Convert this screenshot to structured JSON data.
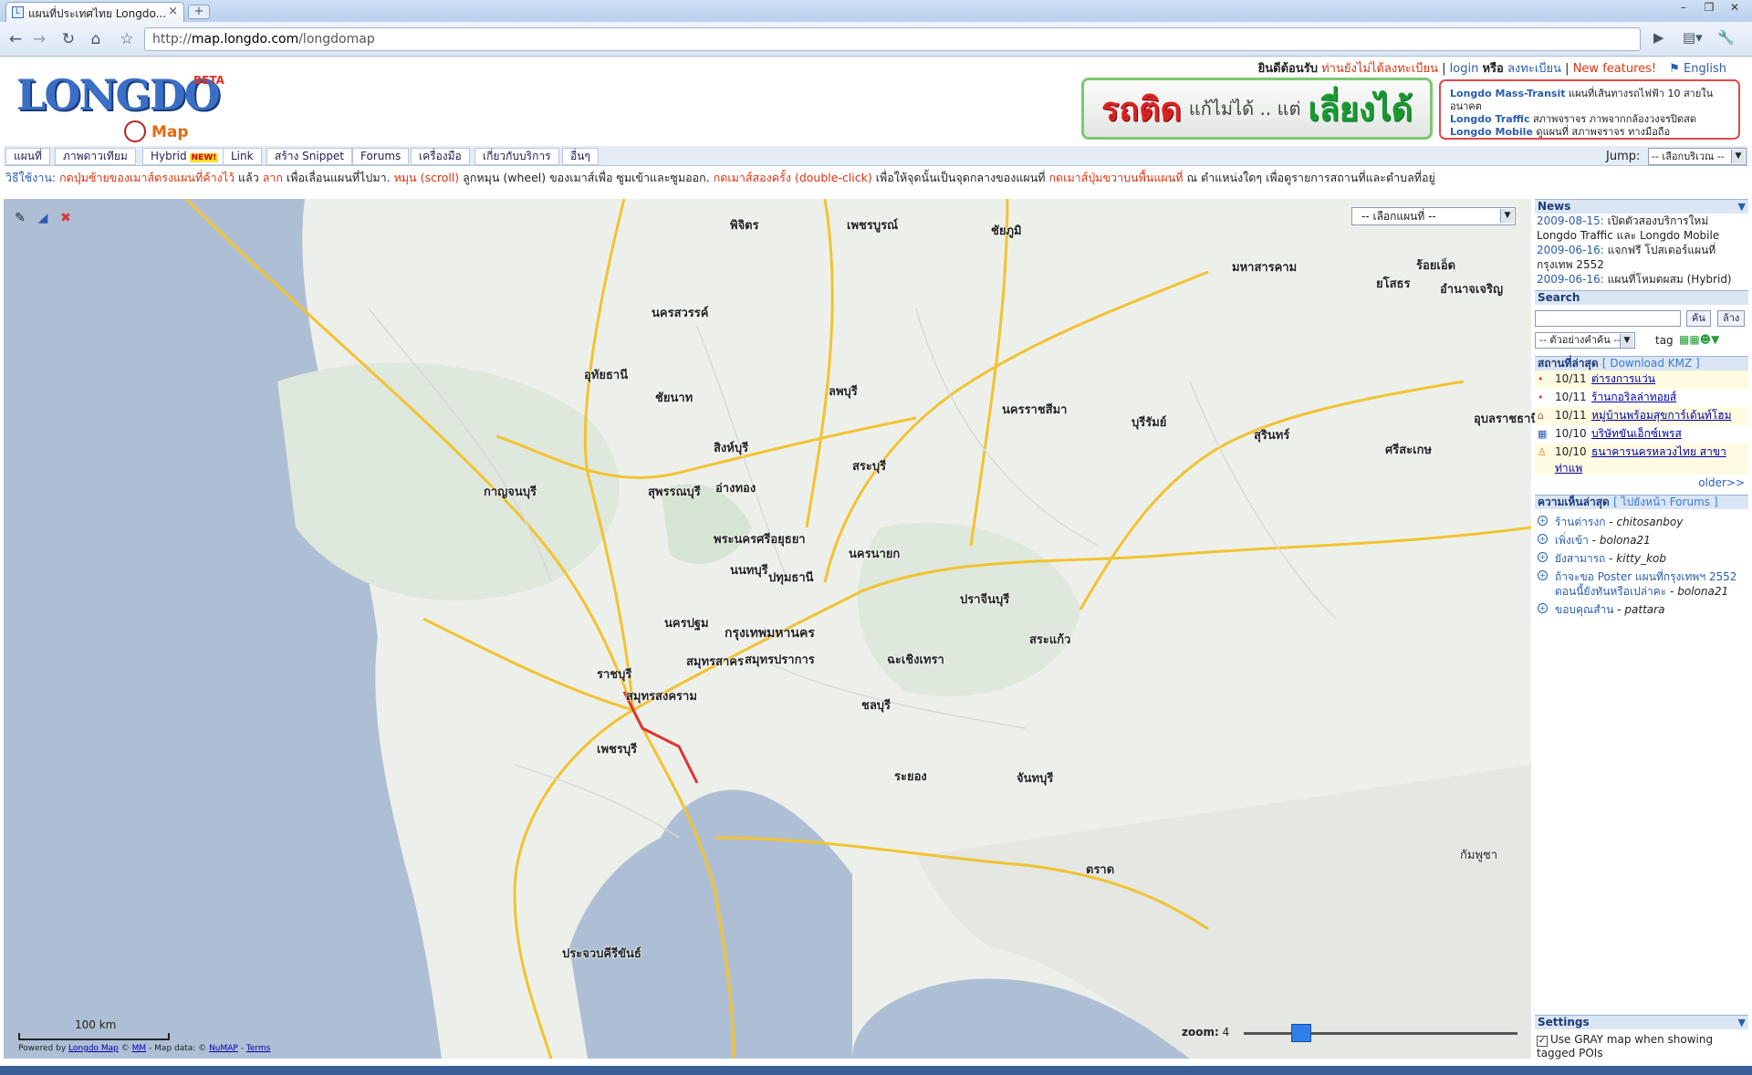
{
  "browser": {
    "tab_title": "แผนที่ประเทศไทย Longdo...",
    "tab_close": "×",
    "new_tab": "+",
    "url_prefix": "http://",
    "url_host": "map.longdo.com",
    "url_path": "/longdomap",
    "window_buttons": [
      "–",
      "❐",
      "✕"
    ]
  },
  "header": {
    "logo": "LONGDO",
    "logo_beta": "BETA",
    "logo_map": "Map",
    "welcome": "ยินดีต้อนรับ",
    "not_registered": "ท่านยังไม่ได้ลงทะเบียน",
    "login": "login",
    "or": "หรือ",
    "register": "ลงทะเบียน",
    "new_features": "New features!",
    "english": "English",
    "sep": "|"
  },
  "banner1": {
    "part1": "รถติด",
    "part2": "แก้ไม่ได้ .. แต่",
    "part3": "เลี่ยงได้"
  },
  "banner2": {
    "lines": [
      {
        "link": "Longdo Mass-Transit",
        "text": "แผนที่เส้นทางรถไฟฟ้า 10 สายในอนาคต"
      },
      {
        "link": "Longdo Traffic",
        "text": "สภาพจราจร ภาพจากกล้องวงจรปิดสด"
      },
      {
        "link": "Longdo Mobile",
        "text": "ดูแผนที่ สภาพจราจร ทางมือถือ"
      }
    ]
  },
  "menu": [
    {
      "label": "แผนที่"
    },
    {
      "label": "ภาพดาวเทียม"
    },
    {
      "label": "Hybrid",
      "badge": "NEW!"
    },
    {
      "label": "Link"
    },
    {
      "label": "สร้าง Snippet"
    },
    {
      "label": "Forums"
    },
    {
      "label": "เครื่องมือ"
    },
    {
      "label": "เกี่ยวกับบริการ"
    },
    {
      "label": "อื่นๆ"
    }
  ],
  "jump": {
    "label": "Jump:",
    "value": "-- เลือกบริเวณ --"
  },
  "howto": {
    "prefix": "วิธีใช้งาน:",
    "t1": "กดปุ่มซ้ายของเมาส์ตรงแผนที่ค้างไว้",
    "t2": "แล้ว",
    "t3": "ลาก",
    "t4": "เพื่อเลื่อนแผนที่ไปมา.",
    "t5": "หมุน (scroll)",
    "t6": "ลูกหมุน (wheel) ของเมาส์เพื่อ ซูมเข้าและซูมออก.",
    "t7": "กดเมาส์สองครั้ง (double-click)",
    "t8": "เพื่อให้จุดนั้นเป็นจุดกลางของแผนที่",
    "t9": "กดเมาส์ปุ่มขวาบนพื้นแผนที่",
    "t10": "ณ ตำแหน่งใดๆ เพื่อดูรายการสถานที่และตำบลที่อยู่"
  },
  "map": {
    "select_value": "-- เลือกแผนที่ --",
    "zoom_label": "zoom:",
    "zoom_value": "4",
    "zoom_level_fraction": 0.21,
    "scale_text": "100 km",
    "powered_prefix": "Powered by",
    "powered_link": "Longdo Map",
    "powered_copy": "©",
    "powered_mm": "MM",
    "powered_data": "- Map data: ©",
    "powered_numap": "NuMAP",
    "powered_dash": "-",
    "powered_terms": "Terms",
    "places": [
      "เพชรบูรณ์",
      "นครสวรรค์",
      "อุทัยธานี",
      "ชัยนาท",
      "ลพบุรี",
      "นครราชสีมา",
      "บุรีรัมย์",
      "สุรินทร์",
      "ศรีสะเกษ",
      "อุบลราชธานี",
      "ร้อยเอ็ด",
      "ยโสธร",
      "อำนาจเจริญ",
      "มหาสารคาม",
      "ชัยภูมิ",
      "พิจิตร",
      "สิงห์บุรี",
      "อ่างทอง",
      "สระบุรี",
      "สุพรรณบุรี",
      "กาญจนบุรี",
      "พระนครศรีอยุธยา",
      "ปทุมธานี",
      "นนทบุรี",
      "นครปฐม",
      "กรุงเทพมหานคร",
      "สมุทรสาคร",
      "สมุทรปราการ",
      "ราชบุรี",
      "สมุทรสงคราม",
      "เพชรบุรี",
      "นครนายก",
      "ปราจีนบุรี",
      "ฉะเชิงเทรา",
      "ชลบุรี",
      "ระยอง",
      "จันทบุรี",
      "สระแก้ว",
      "ตราด",
      "ประจวบคีรีขันธ์",
      "กัมพูชา"
    ]
  },
  "sidebar": {
    "news_title": "News",
    "news": [
      {
        "date": "2009-08-15:",
        "text": "เปิดตัวสองบริการใหม่ Longdo Traffic และ Longdo Mobile"
      },
      {
        "date": "2009-06-16:",
        "text": "แจกฟรี โปสเตอร์แผนที่กรุงเทพ 2552"
      },
      {
        "date": "2009-06-16:",
        "text": "แผนที่โหมดผสม (Hybrid)"
      }
    ],
    "search_title": "Search",
    "search_btn": "ค้น",
    "clear_btn": "ล้าง",
    "example_select": "-- ตัวอย่างคำค้น --",
    "tag_label": "tag",
    "latest_title": "สถานที่ล่าสุด",
    "download_kmz": "[ Download KMZ ]",
    "latest": [
      {
        "date": "10/11",
        "name": "ต่ารงการแว่น",
        "icon": "•"
      },
      {
        "date": "10/11",
        "name": "ร้านกอริลล่าทอยส์",
        "icon": "•"
      },
      {
        "date": "10/11",
        "name": "หมู่บ้านพร้อมสุขการ์เด้นท์โฮม",
        "icon": "⌂"
      },
      {
        "date": "10/10",
        "name": "บริษัทขันเอ็กซ์เพรส",
        "icon": "▦"
      },
      {
        "date": "10/10",
        "name": "ธนาคารนครหลวงไทย สาขาท่าแพ",
        "icon": "♙"
      }
    ],
    "older": "older>>",
    "comments_title": "ความเห็นล่าสุด",
    "forums_link": "[ ไปยังหน้า Forums ]",
    "comments": [
      {
        "link": "ร้านต่ารงก",
        "user": "chitosanboy"
      },
      {
        "link": "เพิ่งเข้า",
        "user": "bolona21"
      },
      {
        "link": "ยังสามารถ",
        "user": "kitty_kob"
      },
      {
        "link": "ถ้าจะขอ Poster แผนที่กรุงเทพฯ 2552 ตอนนี้ยังทันหรือเปล่าคะ",
        "user": "bolona21"
      },
      {
        "link": "ขอบคุณสำน",
        "user": "pattara"
      }
    ],
    "settings_title": "Settings",
    "gray_map_setting": "Use GRAY map when showing tagged POIs"
  }
}
